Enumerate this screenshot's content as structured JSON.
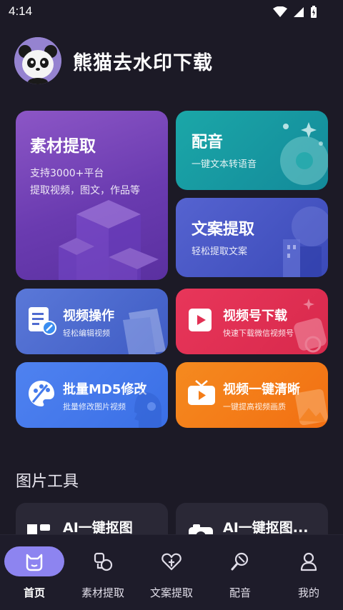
{
  "status_bar": {
    "time": "4:14"
  },
  "header": {
    "title": "熊猫去水印下载"
  },
  "cards": {
    "material": {
      "title": "素材提取",
      "sub1": "支持3000+平台",
      "sub2": "提取视频，图文，作品等"
    },
    "dub": {
      "title": "配音",
      "sub": "一键文本转语音"
    },
    "copy": {
      "title": "文案提取",
      "sub": "轻松提取文案"
    },
    "video_op": {
      "title": "视频操作",
      "sub": "轻松编辑视频"
    },
    "channel": {
      "title": "视频号下载",
      "sub": "快速下载微信视频号"
    },
    "md5": {
      "title": "批量MD5修改",
      "sub": "批量修改图片视频"
    },
    "hd": {
      "title": "视频一键清晰",
      "sub": "一键提高视频画质"
    }
  },
  "image_tools": {
    "section_title": "图片工具",
    "items": [
      {
        "title": "AI一键抠图"
      },
      {
        "title": "AI一键抠图..."
      }
    ]
  },
  "bottom_nav": {
    "items": [
      {
        "label": "首页",
        "icon": "cat-home-icon",
        "active": true
      },
      {
        "label": "素材提取",
        "icon": "material-icon"
      },
      {
        "label": "文案提取",
        "icon": "copy-extract-icon"
      },
      {
        "label": "配音",
        "icon": "dub-icon"
      },
      {
        "label": "我的",
        "icon": "profile-icon"
      }
    ]
  },
  "colors": {
    "background": "#1c1a26",
    "accent": "#8d84f0",
    "material": "#7a47bb",
    "dub": "#1799a2",
    "copy": "#4a57c6",
    "video_op": "#4c6bd0",
    "channel": "#e23054",
    "md5": "#447aeb",
    "hd": "#f47d18"
  }
}
